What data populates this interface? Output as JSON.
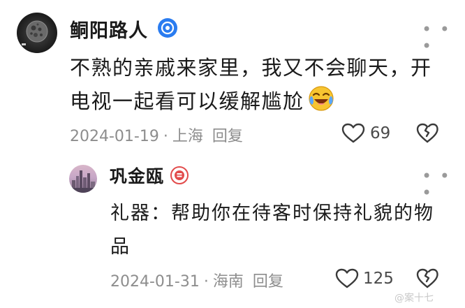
{
  "comments": [
    {
      "author": "鲖阳路人",
      "text": "不熟的亲戚来家里，我又不会聊天，开电视一起看可以缓解尴尬",
      "date": "2024-01-19",
      "location": "上海",
      "reply_label": "回复",
      "likes": "69",
      "emoji": "crying-laughing-face"
    },
    {
      "author": "巩金瓯",
      "text": "礼器：帮助你在待客时保持礼貌的物品",
      "date": "2024-01-31",
      "location": "海南",
      "reply_label": "回复",
      "likes": "125"
    }
  ],
  "more_glyph": "• • •",
  "separator": "·",
  "watermark": "@案十七",
  "colors": {
    "verified_badge": "#2a7cf0",
    "reply_badge": "#e24b4b",
    "meta_text": "#8d8d8d"
  }
}
